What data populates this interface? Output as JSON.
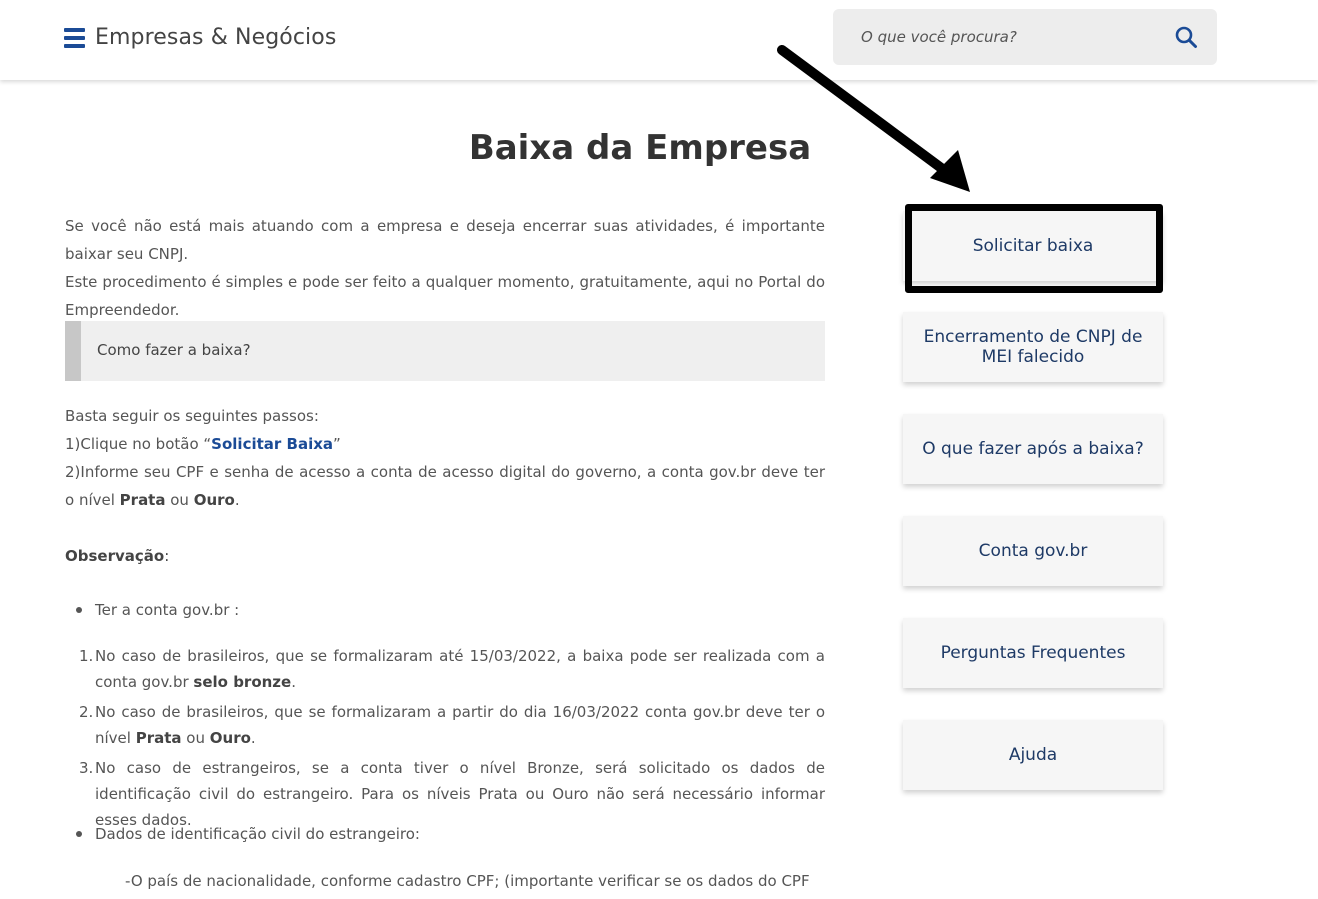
{
  "header": {
    "brand": "Empresas & Negócios",
    "search_placeholder": "O que você procura?"
  },
  "page": {
    "title": "Baixa da Empresa",
    "intro_line1": "Se você não está mais atuando com a empresa e deseja encerrar suas atividades, é importante baixar seu CNPJ.",
    "intro_line2": "Este procedimento é simples e pode ser feito a qualquer momento, gratuitamente, aqui no Portal do Empreendedor.",
    "accordion_label": "Como fazer a baixa?",
    "steps_intro": "Basta seguir os seguintes passos:",
    "step1_prefix": "1)Clique no botão “",
    "step1_link": "Solicitar Baixa",
    "step1_suffix": "”",
    "step2_text": "2)Informe seu CPF e senha de acesso a conta de acesso digital do governo, a conta gov.br deve ter o nível ",
    "step2_prata": "Prata",
    "step2_or": " ou ",
    "step2_ouro": "Ouro",
    "step2_end": ".",
    "obs_label": "Observação",
    "obs_colon": ":",
    "bullet1": "Ter a conta gov.br :",
    "ol": [
      {
        "num": "1.",
        "text": "No caso de brasileiros, que se formalizaram até 15/03/2022, a baixa pode ser realizada com a conta gov.br ",
        "bold": "selo bronze",
        "end": "."
      },
      {
        "num": "2.",
        "text": "No caso de brasileiros, que se formalizaram a partir do dia 16/03/2022 conta gov.br deve ter o nível ",
        "bold": "Prata",
        "mid": " ou ",
        "bold2": "Ouro",
        "end": "."
      },
      {
        "num": "3.",
        "text": "No caso de estrangeiros, se a conta tiver o nível Bronze, será solicitado os dados de identificação civil do estrangeiro. Para os níveis Prata ou Ouro não será necessário informar esses dados."
      }
    ],
    "bullet2": "Dados de identificação civil do estrangeiro:",
    "sub_note": "-O país de nacionalidade, conforme cadastro CPF; (importante verificar se os dados do CPF"
  },
  "sidebar": {
    "buttons": [
      {
        "label": "Solicitar baixa"
      },
      {
        "label": "Encerramento de CNPJ de MEI falecido"
      },
      {
        "label": "O que fazer após a baixa?"
      },
      {
        "label": "Conta gov.br"
      },
      {
        "label": "Perguntas Frequentes"
      },
      {
        "label": "Ajuda"
      }
    ]
  },
  "colors": {
    "brand_blue": "#1b4b96",
    "sidebar_text": "#1e3a66",
    "highlight": "#000000"
  }
}
